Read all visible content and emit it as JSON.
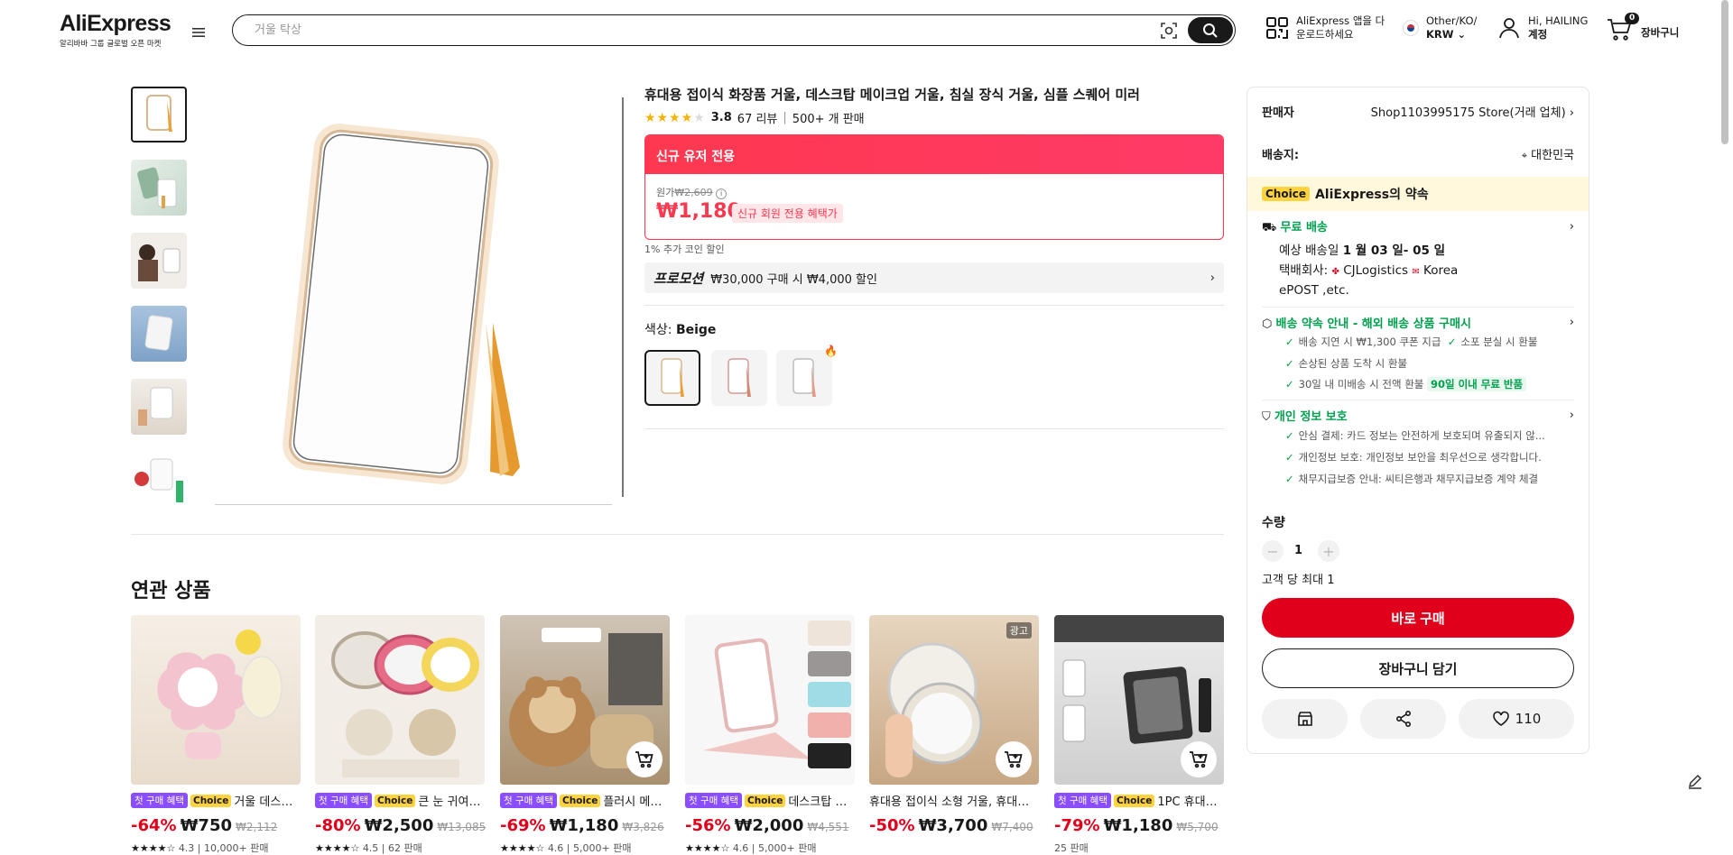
{
  "header": {
    "logo": "AliExpress",
    "logo_sub": "알리바바 그룹 글로벌 오픈 마켓",
    "search_placeholder": "거울 탁상",
    "app_line1": "AliExpress 앱을 다",
    "app_line2": "운로드하세요",
    "region_line1": "Other/KO/",
    "region_line2": "KRW",
    "account_line1": "Hi, HAILING",
    "account_line2": "계정",
    "cart_count": "0",
    "cart_label": "장바구니"
  },
  "product": {
    "title": "휴대용 접이식 화장품 거울, 데스크탑 메이크업 거울, 침실 장식 거울, 심플 스퀘어 미러",
    "rating_value": 3.8,
    "rating": "3.8",
    "reviews": "67 리뷰",
    "sold": "500+ 개 판매",
    "new_user_banner": "신규 유저 전용",
    "orig_label": "원가",
    "orig_price": "₩2,609",
    "price": "₩1,180",
    "new_member_tag": "신규 회원 전용 혜택가",
    "coin_discount": "1% 추가 코인 할인",
    "promo_label": "프로모션",
    "promo_text": "₩30,000 구매 시 ₩4,000 할인",
    "color_label": "색상: ",
    "color_value": "Beige"
  },
  "seller_panel": {
    "seller_label": "판매자",
    "seller_name": "Shop1103995175 Store(거래 업체)",
    "ship_to_label": "배송지:",
    "ship_to_value": "대한민국",
    "choice_tag": "Choice",
    "choice_title": "AliExpress의 약속",
    "free_shipping": "무료 배송",
    "eta_label": "예상 배송일 ",
    "eta_value": "1 월 03 일- 05 일",
    "carrier_label": "택배회사:",
    "carrier_1": "CJLogistics",
    "carrier_2": "Korea",
    "carrier_3": "ePOST ,etc.",
    "promise_title": "배송 약속 안내 - 해외 배송 상품 구매시",
    "promise_1": "배송 지연 시 ₩1,300 쿠폰 지급",
    "promise_2": "소포 분실 시 환불",
    "promise_3": "손상된 상품 도착 시 환불",
    "promise_4": "30일 내 미배송 시 전액 환불",
    "promise_tag": "90일 이내 무료 반품",
    "privacy_title": "개인 정보 보호",
    "privacy_1": "안심 결제: 카드 정보는 안전하게 보호되며 유출되지 않...",
    "privacy_2": "개인정보 보호: 개인정보 보안을 최우선으로 생각합니다.",
    "privacy_3": "채무지급보증 안내: 씨티은행과 채무지급보증 계약 체결",
    "qty_label": "수량",
    "qty_value": "1",
    "limit_text": "고객 당 최대 1",
    "buy_now": "바로 구매",
    "add_cart": "장바구니 담기",
    "wish_count": "110"
  },
  "related": {
    "title": "연관 상품",
    "first_badge": "첫 구매 혜택",
    "choice_badge": "Choice",
    "items": [
      {
        "title": "거울 데스크탑...",
        "disc": "-64%",
        "price": "₩750",
        "orig": "₩2,112",
        "meta": "4.3 | 10,000+ 판매",
        "first": true,
        "choice": true
      },
      {
        "title": "큰 눈 귀여운...",
        "disc": "-80%",
        "price": "₩2,500",
        "orig": "₩13,085",
        "meta": "4.5 | 62 판매",
        "first": true,
        "choice": true
      },
      {
        "title": "플러시 메이크...",
        "disc": "-69%",
        "price": "₩1,180",
        "orig": "₩3,826",
        "meta": "4.6 | 5,000+ 판매",
        "first": true,
        "choice": true
      },
      {
        "title": "데스크탑 메이...",
        "disc": "-56%",
        "price": "₩2,000",
        "orig": "₩4,551",
        "meta": "4.6 | 5,000+ 판매",
        "first": true,
        "choice": true
      },
      {
        "title": "휴대용 접이식 소형 거울, 휴대용...",
        "disc": "-50%",
        "price": "₩3,700",
        "orig": "₩7,400",
        "meta": "",
        "first": false,
        "choice": false,
        "ad": "광고"
      },
      {
        "title": "1PC 휴대용...",
        "disc": "-79%",
        "price": "₩1,180",
        "orig": "₩5,700",
        "meta": "25 판매",
        "first": true,
        "choice": true
      }
    ]
  },
  "colors": {
    "accent": "#fd384f",
    "buy": "#e0001b",
    "green": "#00a04e",
    "choice_yellow": "#ffd33d"
  }
}
